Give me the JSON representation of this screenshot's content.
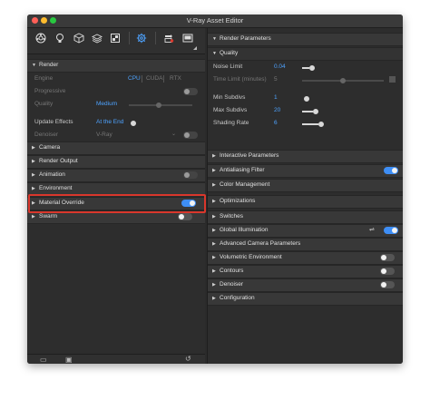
{
  "window": {
    "title": "V-Ray Asset Editor"
  },
  "colors": {
    "accent": "#3e8ef5",
    "value_blue": "#4ea3ff",
    "highlight": "#d9372c"
  },
  "toolbar": {
    "icons": [
      "material-icon",
      "light-icon",
      "geometry-icon",
      "layers-icon",
      "render-element-icon",
      "settings-icon",
      "render-icon",
      "frame-buffer-icon"
    ]
  },
  "left": {
    "render": {
      "header": "Render",
      "engine_label": "Engine",
      "engine_options": [
        "CPU",
        "CUDA",
        "RTX"
      ],
      "progressive_label": "Progressive",
      "quality_label": "Quality",
      "quality_value": "Medium",
      "update_effects_label": "Update Effects",
      "update_effects_value": "At the End",
      "denoiser_label": "Denoiser",
      "denoiser_value": "V-Ray"
    },
    "sections": [
      "Camera",
      "Render Output",
      "Animation",
      "Environment",
      "Material Override",
      "Swarm"
    ]
  },
  "right": {
    "render_parameters": "Render Parameters",
    "quality": {
      "header": "Quality",
      "noise_limit_label": "Noise Limit",
      "noise_limit_value": "0.04",
      "time_limit_label": "Time Limit (minutes)",
      "time_limit_value": "5",
      "min_subdivs_label": "Min Subdivs",
      "min_subdivs_value": "1",
      "max_subdivs_label": "Max Subdivs",
      "max_subdivs_value": "20",
      "shading_rate_label": "Shading Rate",
      "shading_rate_value": "6"
    },
    "sections": [
      "Interactive Parameters",
      "Antialiasing Filter",
      "Color Management",
      "Optimizations",
      "Switches",
      "Global Illumination",
      "Advanced Camera Parameters",
      "Volumetric Environment",
      "Contours",
      "Denoiser",
      "Configuration"
    ]
  }
}
